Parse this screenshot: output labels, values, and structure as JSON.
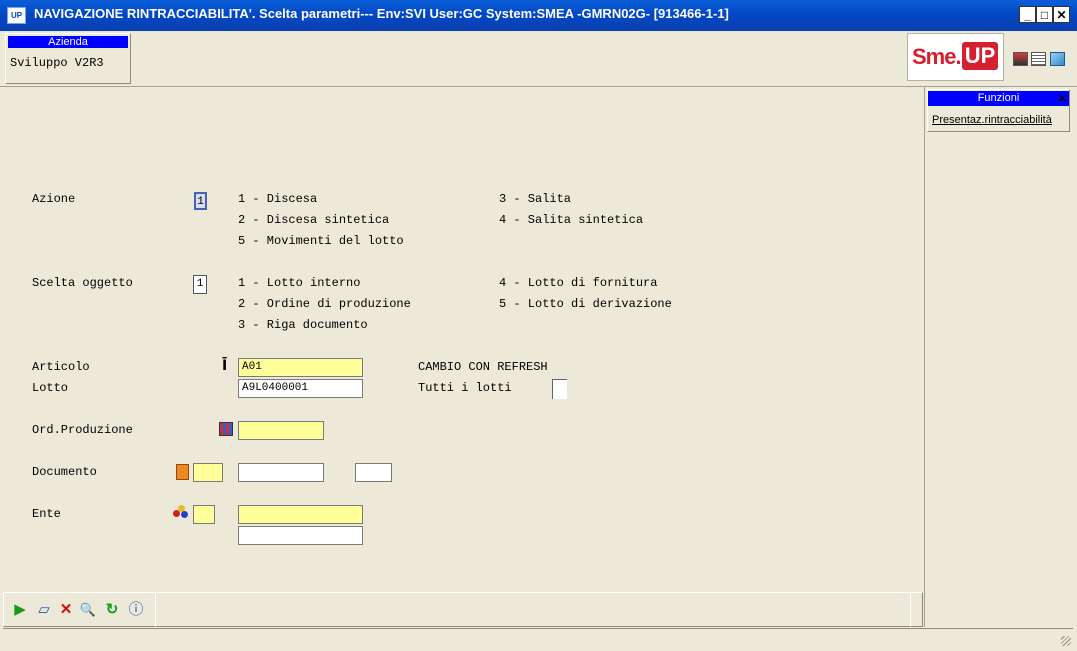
{
  "window": {
    "app_icon_label": "UP",
    "title": "NAVIGAZIONE RINTRACCIABILITA'.  Scelta parametri--- Env:SVI User:GC System:SMEA -GMRN02G- [913466-1-1]",
    "minimize_label": "_",
    "maximize_label": "□",
    "close_label": "✕"
  },
  "header": {
    "azienda_label": "Azienda",
    "azienda_value": "Sviluppo V2R3",
    "logo_sme": "Sme.",
    "logo_up": "UP"
  },
  "form": {
    "azione": {
      "label": "Azione",
      "value": "1",
      "options": [
        "1 - Discesa",
        "3 - Salita",
        "2 - Discesa sintetica",
        "4 - Salita sintetica",
        "5 - Movimenti del lotto"
      ]
    },
    "scelta_oggetto": {
      "label": "Scelta oggetto",
      "value": "1",
      "options": [
        "1 - Lotto interno",
        "4 - Lotto di fornitura",
        "2 - Ordine di produzione",
        "5 - Lotto di derivazione",
        "3 - Riga documento"
      ]
    },
    "articolo": {
      "label": "Articolo",
      "value": "A01"
    },
    "lotto": {
      "label": "Lotto",
      "value": "A9L0400001"
    },
    "cambio_refresh": "CAMBIO CON REFRESH",
    "tutti_lotti": {
      "label": "Tutti i lotti",
      "checked": false
    },
    "ord_produzione": {
      "label": "Ord.Produzione",
      "value": ""
    },
    "documento": {
      "label": "Documento",
      "value1": "",
      "value2": "",
      "value3": ""
    },
    "ente": {
      "label": "Ente",
      "value1": "",
      "value2": "",
      "value3": ""
    }
  },
  "side_panel": {
    "title": "Funzioni",
    "close_label": "✕",
    "items": [
      "Presentaz.rintracciabilità"
    ]
  },
  "toolbar": {
    "buttons": [
      {
        "icon": "play-icon",
        "glyph": "▶",
        "color": "#1a9a1a"
      },
      {
        "icon": "eraser-icon",
        "glyph": "▱",
        "color": "#2050c0"
      },
      {
        "icon": "delete-icon",
        "glyph": "✕",
        "color": "#d01010"
      },
      {
        "icon": "search-icon",
        "glyph": "🔍",
        "color": "#2050c0"
      },
      {
        "icon": "refresh-icon",
        "glyph": "↻",
        "color": "#1a9a1a"
      },
      {
        "icon": "info-icon",
        "glyph": "ⓘ",
        "color": "#2050c0"
      }
    ]
  },
  "colors": {
    "title_blue": "#0348c4",
    "input_yellow": "#ffff99",
    "panel_head": "#0000ff"
  }
}
